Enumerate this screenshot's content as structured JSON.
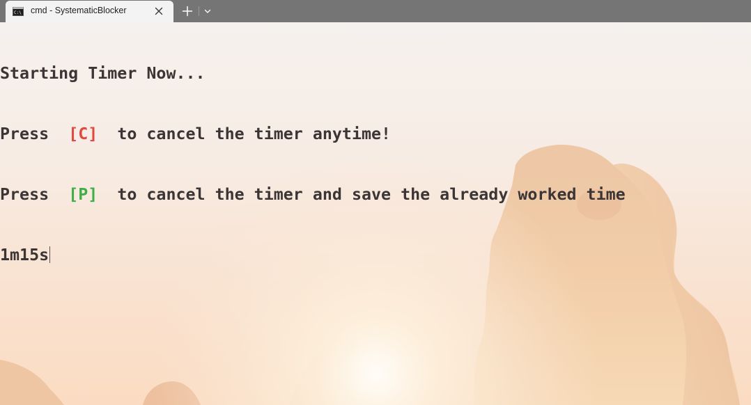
{
  "tab": {
    "title": "cmd - SystematicBlocker",
    "icon": "terminal-icon"
  },
  "terminal": {
    "line1": "Starting Timer Now...",
    "line2": {
      "prefix": "Press  ",
      "key": "[C]",
      "suffix": "  to cancel the timer anytime!"
    },
    "line3": {
      "prefix": "Press  ",
      "key": "[P]",
      "suffix": "  to cancel the timer and save the already worked time"
    },
    "line4": "1m15s"
  },
  "colors": {
    "tabbar": "#757575",
    "tab": "#f3f3f3",
    "text": "#3b3535",
    "key_cancel": "#e0493d",
    "key_save": "#3fae46"
  }
}
